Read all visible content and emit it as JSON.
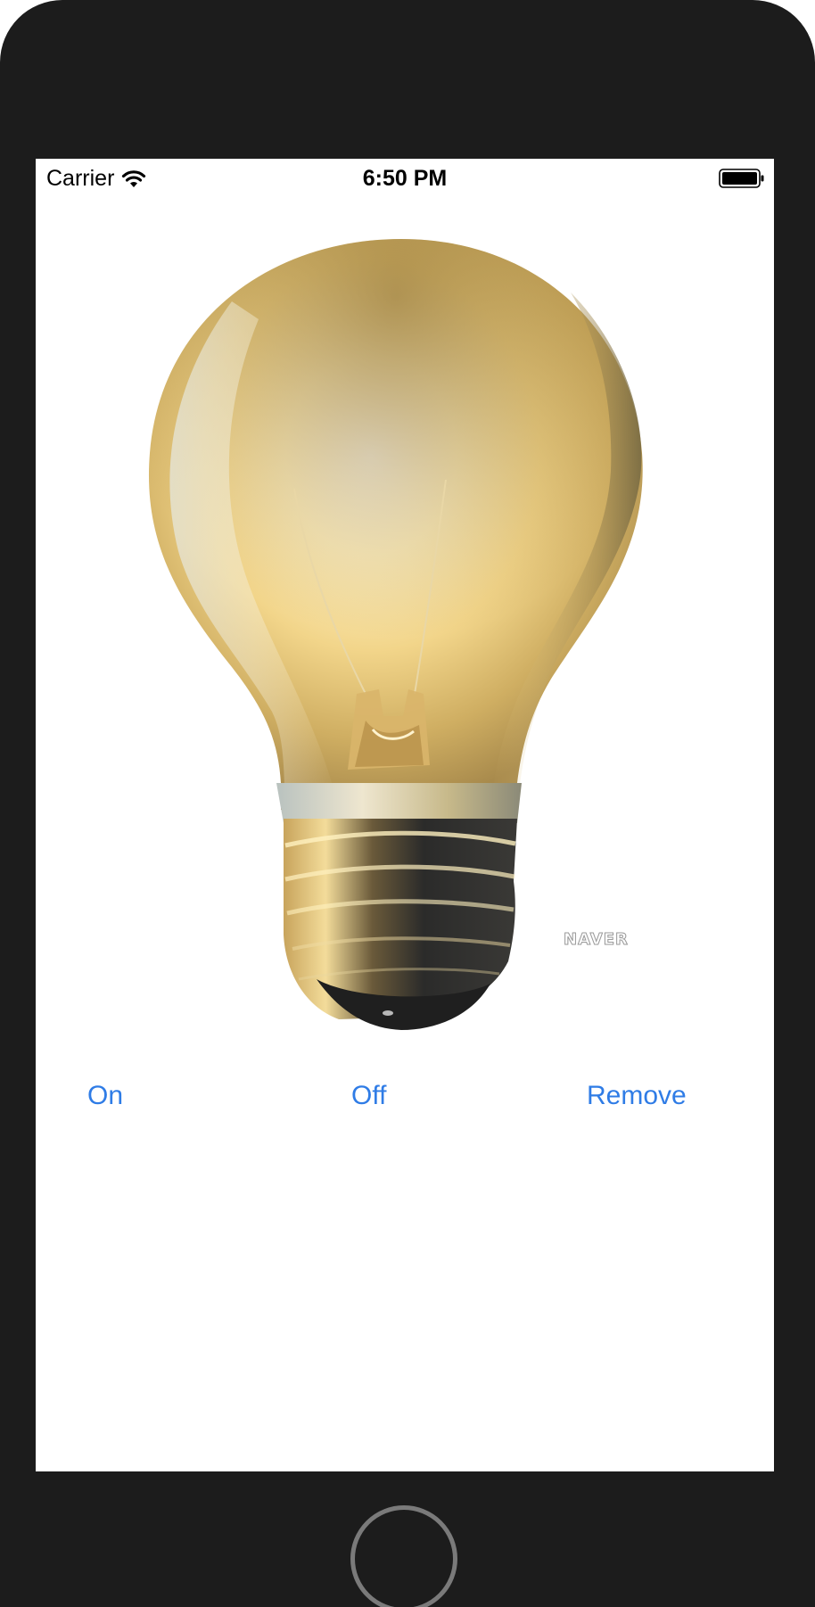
{
  "status_bar": {
    "carrier": "Carrier",
    "time": "6:50 PM",
    "wifi_icon": "wifi-icon",
    "battery_icon": "battery-full-icon"
  },
  "main": {
    "image_watermark": "NAVER",
    "buttons": {
      "on_label": "On",
      "off_label": "Off",
      "remove_label": "Remove"
    },
    "button_color": "#2f7ce6"
  },
  "device": {
    "frame_color": "#1c1c1c",
    "home_button_icon": "home-button"
  }
}
